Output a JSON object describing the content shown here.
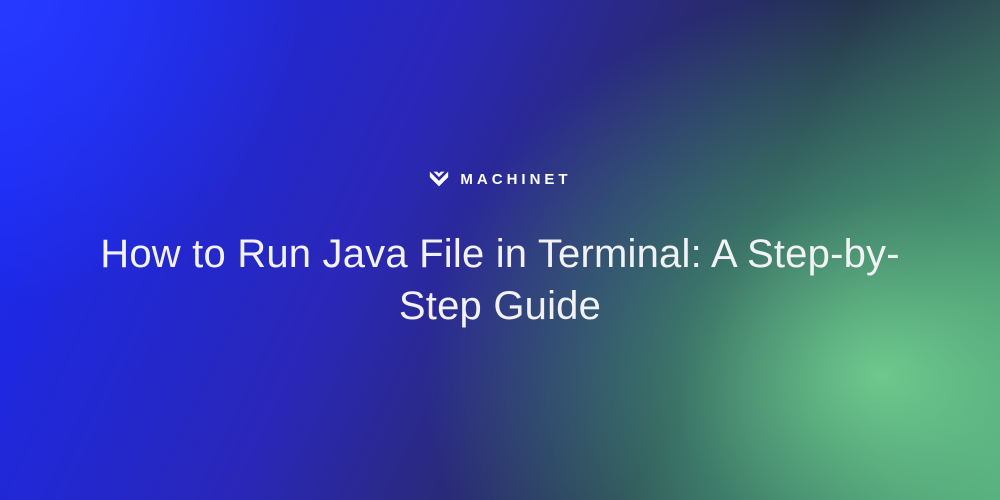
{
  "brand": {
    "name": "MACHINET",
    "icon": "machinet-logo-icon"
  },
  "title": "How to Run Java File in Terminal: A Step-by-Step Guide",
  "colors": {
    "text": "#f2f2f5",
    "gradient_start": "#1a2aff",
    "gradient_end": "#5aa779"
  }
}
